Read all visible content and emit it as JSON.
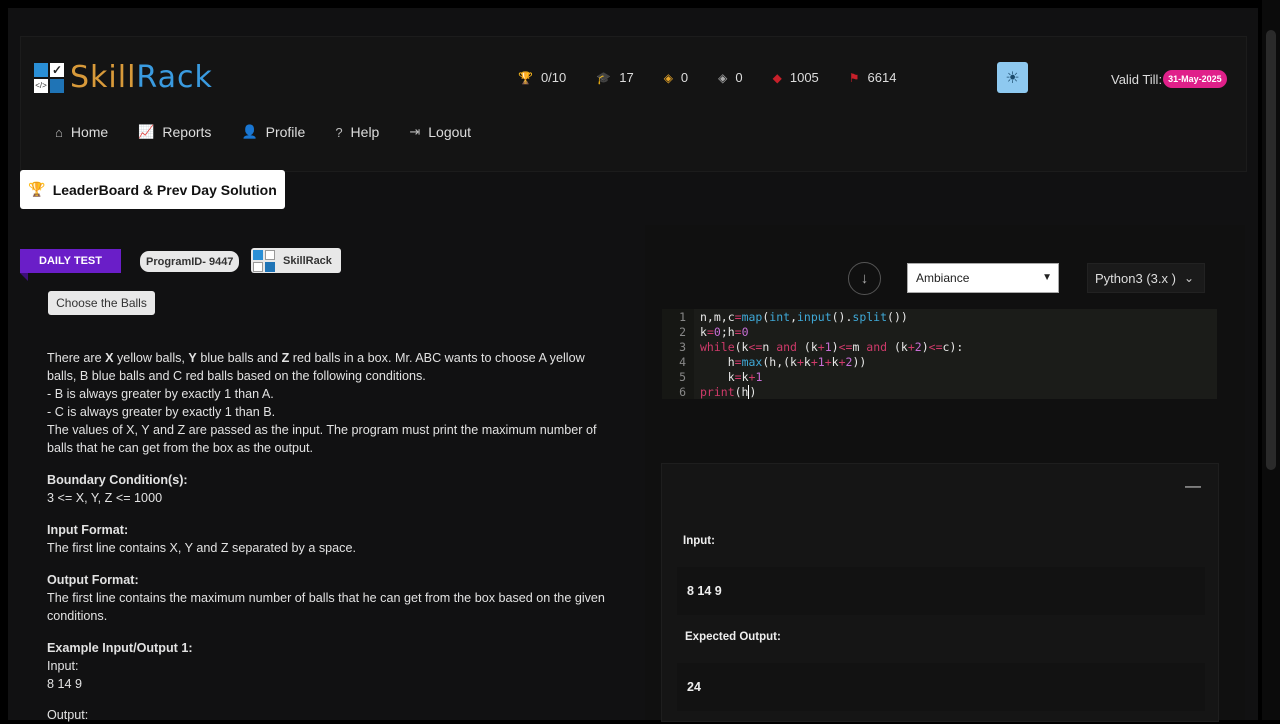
{
  "brand": {
    "part1": "Skill",
    "part2": "Rack"
  },
  "stats": [
    {
      "icon": "trophy-icon",
      "glyph": "🏆",
      "value": "0/10"
    },
    {
      "icon": "graduation-cap-icon",
      "glyph": "🎓",
      "value": "17"
    },
    {
      "icon": "gold-badge-icon",
      "glyph": "◈",
      "value": "0"
    },
    {
      "icon": "silver-badge-icon",
      "glyph": "◈",
      "value": "0"
    },
    {
      "icon": "red-gem-icon",
      "glyph": "◆",
      "value": "1005"
    },
    {
      "icon": "flag-icon",
      "glyph": "⚑",
      "value": "6614"
    }
  ],
  "valid": {
    "label": "Valid Till:",
    "date": "31-May-2025"
  },
  "nav": [
    {
      "icon": "home-icon",
      "glyph": "⌂",
      "label": "Home"
    },
    {
      "icon": "chart-icon",
      "glyph": "📈",
      "label": "Reports"
    },
    {
      "icon": "user-icon",
      "glyph": "👤",
      "label": "Profile"
    },
    {
      "icon": "help-icon",
      "glyph": "?",
      "label": "Help"
    },
    {
      "icon": "logout-icon",
      "glyph": "⇥",
      "label": "Logout"
    }
  ],
  "leaderboard_btn": "LeaderBoard & Prev Day Solution",
  "badges": {
    "daily": "DAILY TEST",
    "program": "ProgramID- 9447",
    "skillrack": "SkillRack"
  },
  "choose_btn": "Choose the Balls",
  "problem": {
    "intro_pre": "There are ",
    "x": "X",
    "mid1": " yellow balls, ",
    "y": "Y",
    "mid2": " blue balls and ",
    "z": "Z",
    "intro_post": " red balls in a box. Mr. ABC wants to choose A yellow balls, B blue balls and C red balls based on the following conditions.",
    "cond1": "- B is always greater by exactly 1 than A.",
    "cond2": "- C is always greater by exactly 1 than B.",
    "desc": "The values of X, Y and Z are passed as the input. The program must print the maximum number of balls that he can get from the box as the output.",
    "boundary_h": "Boundary Condition(s):",
    "boundary": "3 <= X, Y, Z <= 1000",
    "input_h": "Input Format:",
    "input": "The first line contains X, Y and Z separated by a space.",
    "output_h": "Output Format:",
    "output": "The first line contains the maximum number of balls that he can get from the box based on the given conditions.",
    "example_h": "Example Input/Output 1:",
    "ex_input_label": "Input:",
    "ex_input": "8 14 9",
    "ex_output_label": "Output:"
  },
  "editor": {
    "theme": "Ambiance",
    "language": "Python3 (3.x )",
    "line_numbers": [
      "1",
      "2",
      "3",
      "4",
      "5",
      "6"
    ]
  },
  "result": {
    "input_label": "Input:",
    "input_value": "8 14 9",
    "expected_label": "Expected Output:",
    "expected_value": "24"
  }
}
